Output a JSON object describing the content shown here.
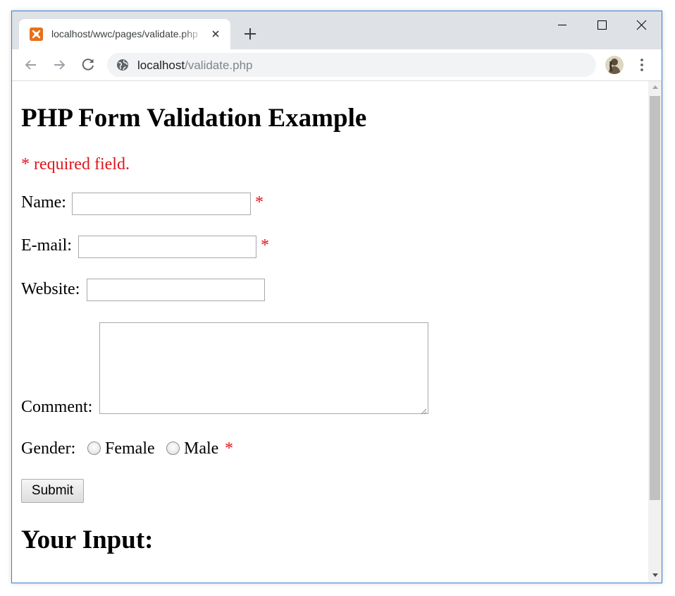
{
  "browser": {
    "tab": {
      "title": "localhost/wwc/pages/validate.php",
      "favicon": "xampp-icon",
      "accent": "#e8701a"
    },
    "url": {
      "host": "localhost",
      "path": "/validate.php"
    },
    "icons": {
      "back": "arrow-left-icon",
      "forward": "arrow-right-icon",
      "reload": "reload-icon",
      "site": "globe-icon",
      "menu": "kebab-menu-icon",
      "new_tab": "plus-icon",
      "close_tab": "close-icon"
    },
    "window_controls": [
      "minimize",
      "maximize",
      "close"
    ]
  },
  "page": {
    "title": "PHP Form Validation Example",
    "required_note": "* required field.",
    "required_marker": "*",
    "required_color": "#e0151b",
    "fields": {
      "name": {
        "label": "Name:",
        "value": ""
      },
      "email": {
        "label": "E-mail:",
        "value": ""
      },
      "website": {
        "label": "Website:",
        "value": ""
      },
      "comment": {
        "label": "Comment:",
        "value": ""
      }
    },
    "gender": {
      "label": "Gender:",
      "options": [
        {
          "label": "Female",
          "checked": false
        },
        {
          "label": "Male",
          "checked": false
        }
      ]
    },
    "submit_label": "Submit",
    "output_heading": "Your Input:"
  }
}
